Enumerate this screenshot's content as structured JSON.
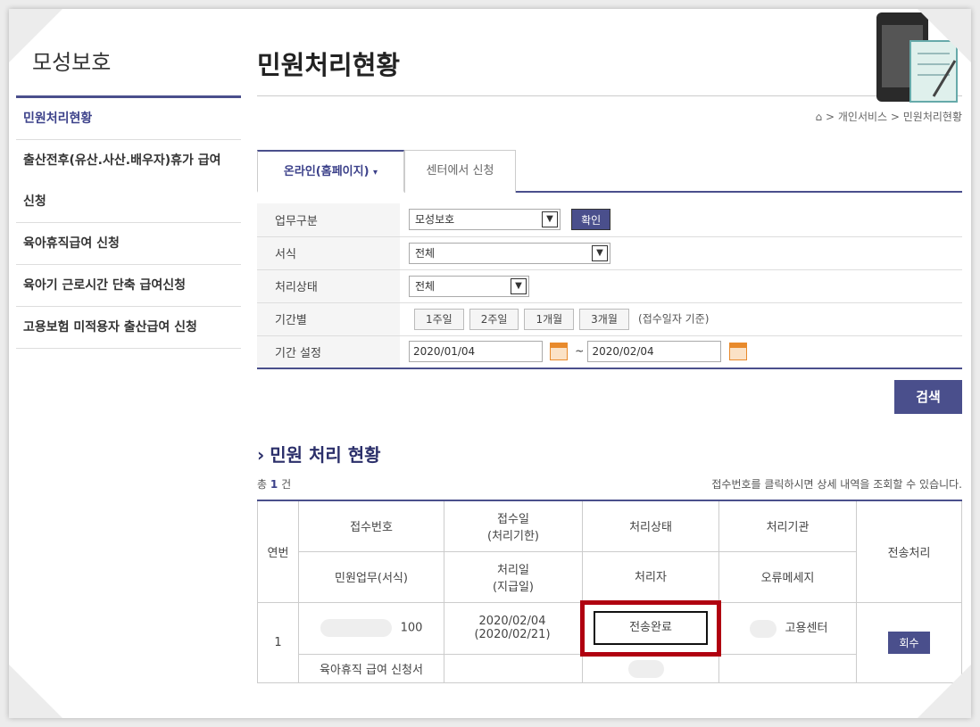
{
  "sidebar": {
    "title": "모성보호",
    "items": [
      {
        "label": "민원처리현황"
      },
      {
        "label": "출산전후(유산.사산.배우자)휴가 급여"
      },
      {
        "label": "신청"
      },
      {
        "label": "육아휴직급여 신청"
      },
      {
        "label": "육아기 근로시간 단축 급여신청"
      },
      {
        "label": "고용보험 미적용자 출산급여 신청"
      }
    ]
  },
  "header": {
    "title": "민원처리현황",
    "breadcrumb": "> 개인서비스 > 민원처리현황"
  },
  "tabs": [
    {
      "label": "온라인(홈페이지)",
      "caret": "▾"
    },
    {
      "label": "센터에서 신청"
    }
  ],
  "form": {
    "rows": [
      {
        "label": "업무구분",
        "select": "모성보호",
        "button": "확인"
      },
      {
        "label": "서식",
        "select": "전체"
      },
      {
        "label": "처리상태",
        "select": "전체"
      },
      {
        "label": "기간별",
        "periods": [
          "1주일",
          "2주일",
          "1개월",
          "3개월"
        ],
        "note": "(접수일자 기준)"
      },
      {
        "label": "기간 설정",
        "from": "2020/01/04",
        "sep": "~",
        "to": "2020/02/04"
      }
    ],
    "search_label": "검색"
  },
  "results": {
    "section_title": "민원 처리 현황",
    "count_prefix": "총",
    "count": "1",
    "count_suffix": "건",
    "hint": "접수번호를 클릭하시면 상세 내역을 조회할 수 있습니다.",
    "headers": {
      "no": "연번",
      "receipt_no": "접수번호",
      "receipt_date": "접수일",
      "receipt_deadline": "(처리기한)",
      "status": "처리상태",
      "agency": "처리기관",
      "transmit": "전송처리",
      "task": "민원업무(서식)",
      "process_date": "처리일",
      "pay_date": "(지급일)",
      "handler": "처리자",
      "error": "오류메세지"
    },
    "row": {
      "no": "1",
      "receipt_no_suffix": "100",
      "receipt_date": "2020/02/04",
      "deadline": "(2020/02/21)",
      "status": "전송완료",
      "agency": "고용센터",
      "withdraw": "회수",
      "task": "육아휴직 급여 신청서"
    }
  },
  "colors": {
    "accent": "#4a4f8c",
    "highlight": "#b00010"
  }
}
